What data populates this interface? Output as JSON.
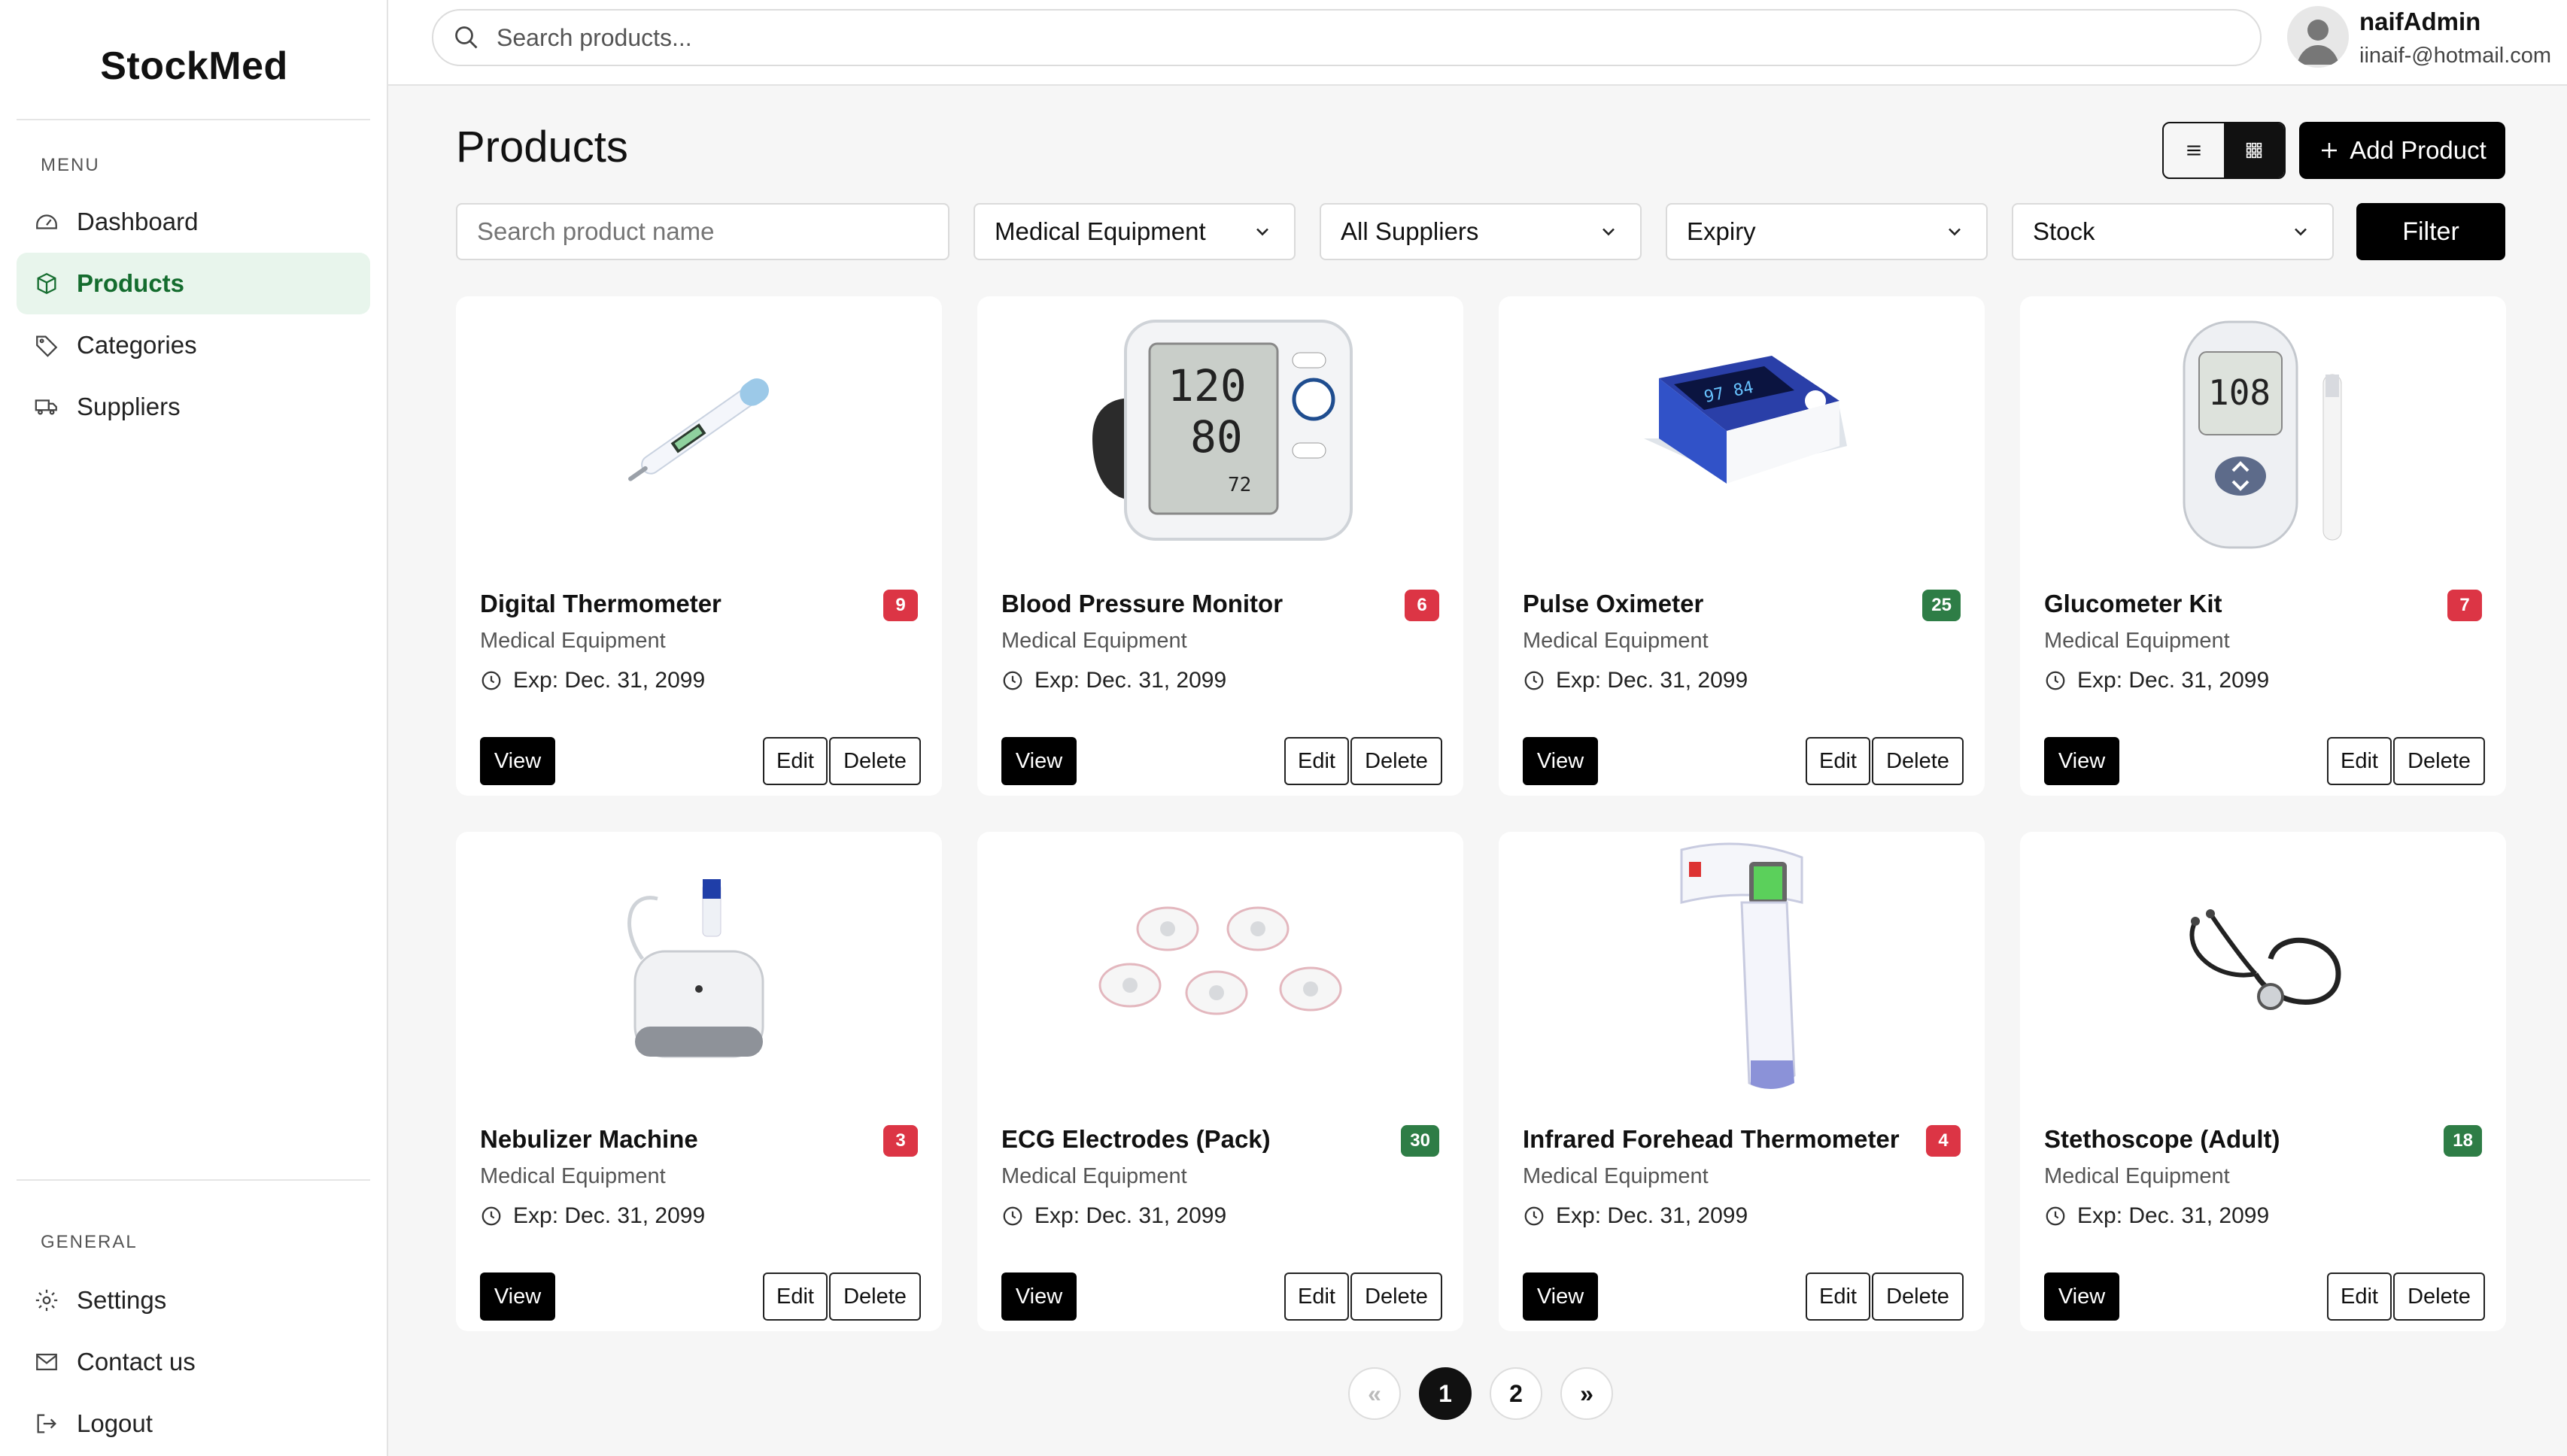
{
  "brand": "StockMed",
  "sidebar": {
    "menu_label": "MENU",
    "general_label": "GENERAL",
    "menu_items": [
      {
        "label": "Dashboard",
        "icon": "dashboard-gauge-icon"
      },
      {
        "label": "Products",
        "icon": "box-icon",
        "active": true
      },
      {
        "label": "Categories",
        "icon": "tag-icon"
      },
      {
        "label": "Suppliers",
        "icon": "truck-icon"
      }
    ],
    "general_items": [
      {
        "label": "Settings",
        "icon": "gear-icon"
      },
      {
        "label": "Contact us",
        "icon": "envelope-icon"
      },
      {
        "label": "Logout",
        "icon": "logout-icon"
      }
    ]
  },
  "topbar": {
    "search_placeholder": "Search products...",
    "user_name": "naifAdmin",
    "user_email": "iinaif-@hotmail.com"
  },
  "main": {
    "title": "Products",
    "add_button": "Add Product",
    "filters": {
      "name_placeholder": "Search product name",
      "category": "Medical Equipment",
      "supplier": "All Suppliers",
      "expiry": "Expiry",
      "stock": "Stock",
      "filter_button": "Filter"
    },
    "card_labels": {
      "view": "View",
      "edit": "Edit",
      "delete": "Delete"
    },
    "products": [
      {
        "name": "Digital Thermometer",
        "category": "Medical Equipment",
        "expiry": "Exp: Dec. 31, 2099",
        "stock": "9",
        "status": "low",
        "image": "thermometer"
      },
      {
        "name": "Blood Pressure Monitor",
        "category": "Medical Equipment",
        "expiry": "Exp: Dec. 31, 2099",
        "stock": "6",
        "status": "low",
        "image": "bp-monitor"
      },
      {
        "name": "Pulse Oximeter",
        "category": "Medical Equipment",
        "expiry": "Exp: Dec. 31, 2099",
        "stock": "25",
        "status": "ok",
        "image": "oximeter"
      },
      {
        "name": "Glucometer Kit",
        "category": "Medical Equipment",
        "expiry": "Exp: Dec. 31, 2099",
        "stock": "7",
        "status": "low",
        "image": "glucometer"
      },
      {
        "name": "Nebulizer Machine",
        "category": "Medical Equipment",
        "expiry": "Exp: Dec. 31, 2099",
        "stock": "3",
        "status": "low",
        "image": "nebulizer"
      },
      {
        "name": "ECG Electrodes (Pack)",
        "category": "Medical Equipment",
        "expiry": "Exp: Dec. 31, 2099",
        "stock": "30",
        "status": "ok",
        "image": "electrodes"
      },
      {
        "name": "Infrared Forehead Thermometer",
        "category": "Medical Equipment",
        "expiry": "Exp: Dec. 31, 2099",
        "stock": "4",
        "status": "low",
        "image": "ir-thermometer"
      },
      {
        "name": "Stethoscope (Adult)",
        "category": "Medical Equipment",
        "expiry": "Exp: Dec. 31, 2099",
        "stock": "18",
        "status": "ok",
        "image": "stethoscope"
      }
    ]
  },
  "pagination": {
    "prev": "«",
    "pages": [
      "1",
      "2"
    ],
    "current": "1",
    "next": "»"
  },
  "colors": {
    "accent": "#146c2e",
    "active_bg": "#e8f5ec",
    "low_stock": "#dc3545",
    "ok_stock": "#2e7d46",
    "button": "#000000"
  }
}
